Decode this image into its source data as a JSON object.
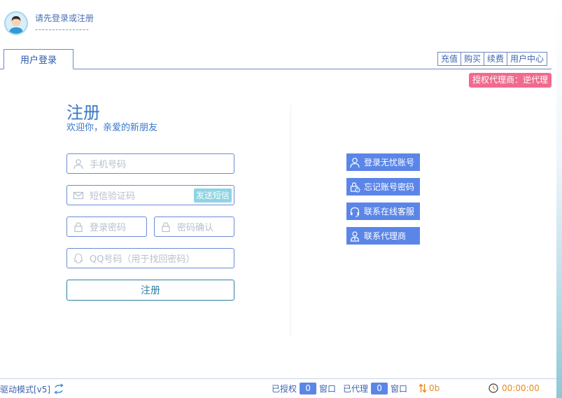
{
  "header": {
    "login_hint": "请先登录或注册",
    "placeholder_line": "----------------"
  },
  "tabs": {
    "login_tab": "用户登录"
  },
  "top_links": [
    {
      "label": "充值"
    },
    {
      "label": "购买"
    },
    {
      "label": "续费"
    },
    {
      "label": "用户中心"
    }
  ],
  "agent_badge": "授权代理商：逆代理",
  "register": {
    "title": "注册",
    "subtitle": "欢迎你，亲爱的新朋友",
    "phone_placeholder": "手机号码",
    "sms_placeholder": "短信验证码",
    "send_sms_label": "发送短信",
    "password_placeholder": "登录密码",
    "confirm_placeholder": "密码确认",
    "qq_placeholder": "QQ号码（用于找回密码）",
    "submit_label": "注册"
  },
  "actions": [
    {
      "label": "登录无忧账号",
      "icon": "user-icon"
    },
    {
      "label": "忘记账号密码",
      "icon": "lock-question-icon"
    },
    {
      "label": "联系在线客服",
      "icon": "headset-icon"
    },
    {
      "label": "联系代理商",
      "icon": "agent-icon"
    }
  ],
  "statusbar": {
    "mode": "驱动模式[v5]",
    "authorized_label": "已授权",
    "authorized_count": "0",
    "window_label_1": "窗口",
    "agent_label": "已代理",
    "agent_count": "0",
    "window_label_2": "窗口",
    "traffic": "0b",
    "timer": "00:00:00"
  },
  "colors": {
    "accent": "#5b86e8",
    "link": "#3f63b0",
    "badge": "#f06a8d",
    "orange": "#e8891f"
  }
}
